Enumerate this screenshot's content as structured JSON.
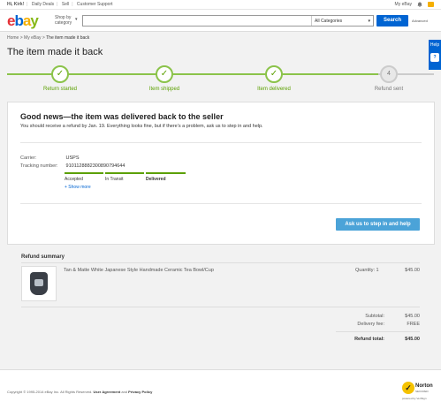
{
  "topbar": {
    "greeting": "Hi, Kirk!",
    "links": [
      "Daily Deals",
      "Sell",
      "Customer Support"
    ],
    "my_ebay": "My eBay"
  },
  "header": {
    "logo_letters": [
      "e",
      "b",
      "a",
      "y"
    ],
    "shop_by_line1": "Shop by",
    "shop_by_line2": "category",
    "search_placeholder": "",
    "category_select": "All Categories",
    "search_button": "Search",
    "advanced_link": "Advanced"
  },
  "breadcrumb": [
    "Home",
    "My eBay",
    "The item made it back"
  ],
  "page_title": "The item made it back",
  "help_tab": {
    "label": "Help",
    "icon_text": "?"
  },
  "progress": {
    "steps": [
      {
        "label": "Return started",
        "state": "done"
      },
      {
        "label": "Item shipped",
        "state": "done"
      },
      {
        "label": "Item delivered",
        "state": "done"
      },
      {
        "label": "Refund sent",
        "state": "pending",
        "number": "4"
      }
    ]
  },
  "status_card": {
    "heading": "Good news—the item was delivered back to the seller",
    "subtext": "You should receive a refund by Jan. 19. Everything looks fine, but if there’s a problem, ask us to step in and help.",
    "carrier_label": "Carrier:",
    "carrier_value": "USPS",
    "tracking_label": "Tracking number:",
    "tracking_value": "9101128882300890794644",
    "tracking_steps": [
      "Accepted",
      "In Transit",
      "Delivered"
    ],
    "show_more": "+ Show more",
    "ask_button": "Ask us to step in and help"
  },
  "refund_summary": {
    "title": "Refund summary",
    "item_name": "Tan & Matte White Japanese Style Handmade Ceramic Tea Bowl/Cup",
    "quantity": "Quantity: 1",
    "item_price": "$45.00",
    "subtotal_label": "Subtotal:",
    "subtotal_value": "$45.00",
    "delivery_label": "Delivery fee:",
    "delivery_value": "FREE",
    "total_label": "Refund total:",
    "total_value": "$45.00"
  },
  "footer": {
    "copyright": "Copyright © 1995-2014 eBay Inc. All Rights Reserved.",
    "user_agreement": "User Agreement",
    "and": "and",
    "privacy": "Privacy Policy",
    "norton_title": "Norton",
    "norton_secured": "SECURED",
    "norton_by": "powered by VeriSign"
  },
  "colors": {
    "accent": "#0064d2",
    "success": "#5ba000",
    "ask_button": "#4ba3d8"
  }
}
